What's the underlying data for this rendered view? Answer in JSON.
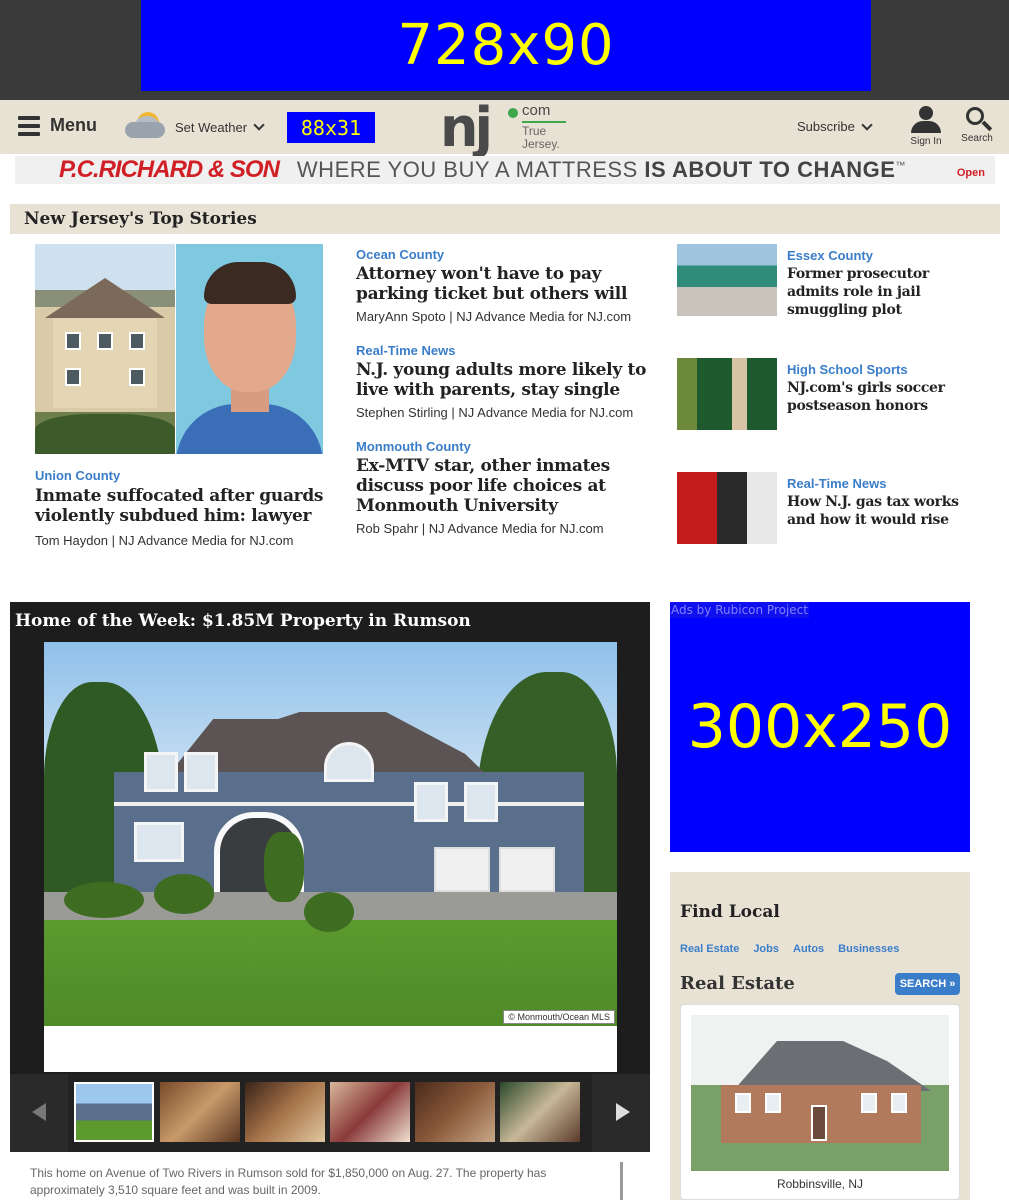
{
  "ads": {
    "top_leaderboard": "728x90",
    "header_small": "88x31",
    "rectangle": "300x250",
    "rectangle_label": "Ads by Rubicon Project"
  },
  "header": {
    "menu_label": "Menu",
    "weather_label": "Set Weather",
    "logo_main": "nj",
    "logo_com": "com",
    "logo_tagline": "True Jersey.",
    "subscribe_label": "Subscribe",
    "signin_label": "Sign In",
    "search_label": "Search"
  },
  "banner": {
    "brand": "P.C.RICHARD & SON",
    "text_pre": "WHERE YOU BUY A MATTRESS",
    "text_bold": "IS ABOUT TO CHANGE",
    "tm": "™",
    "open": "Open"
  },
  "top_stories": {
    "title": "New Jersey's Top Stories",
    "lead": {
      "category": "Union County",
      "headline": "Inmate suffocated after guards violently subdued him: lawyer",
      "byline": "Tom Haydon | NJ Advance Media for NJ.com"
    },
    "middle": [
      {
        "category": "Ocean County",
        "headline": "Attorney won't have to pay parking ticket but others will",
        "byline": "MaryAnn Spoto | NJ Advance Media for NJ.com"
      },
      {
        "category": "Real-Time News",
        "headline": "N.J. young adults more likely to live with parents, stay single",
        "byline": "Stephen Stirling | NJ Advance Media for NJ.com"
      },
      {
        "category": "Monmouth County",
        "headline": "Ex-MTV star, other inmates discuss poor life choices at Monmouth University",
        "byline": "Rob Spahr | NJ Advance Media for NJ.com"
      }
    ],
    "side": [
      {
        "category": "Essex County",
        "headline": "Former prosecutor admits role in jail smuggling plot"
      },
      {
        "category": "High School Sports",
        "headline": "NJ.com's girls soccer postseason honors"
      },
      {
        "category": "Real-Time News",
        "headline": "How N.J. gas tax works and how it would rise"
      }
    ]
  },
  "gallery": {
    "title": "Home of the Week: $1.85M Property in Rumson",
    "copyright": "© Monmouth/Ocean MLS",
    "caption": "This home on Avenue of Two Rivers in Rumson sold for $1,850,000 on Aug. 27. The property has approximately 3,510 square feet and was built in 2009."
  },
  "find_local": {
    "title": "Find Local",
    "tabs": [
      "Real Estate",
      "Jobs",
      "Autos",
      "Businesses"
    ],
    "section": "Real Estate",
    "search_button": "SEARCH »",
    "listing_location": "Robbinsville, NJ"
  }
}
